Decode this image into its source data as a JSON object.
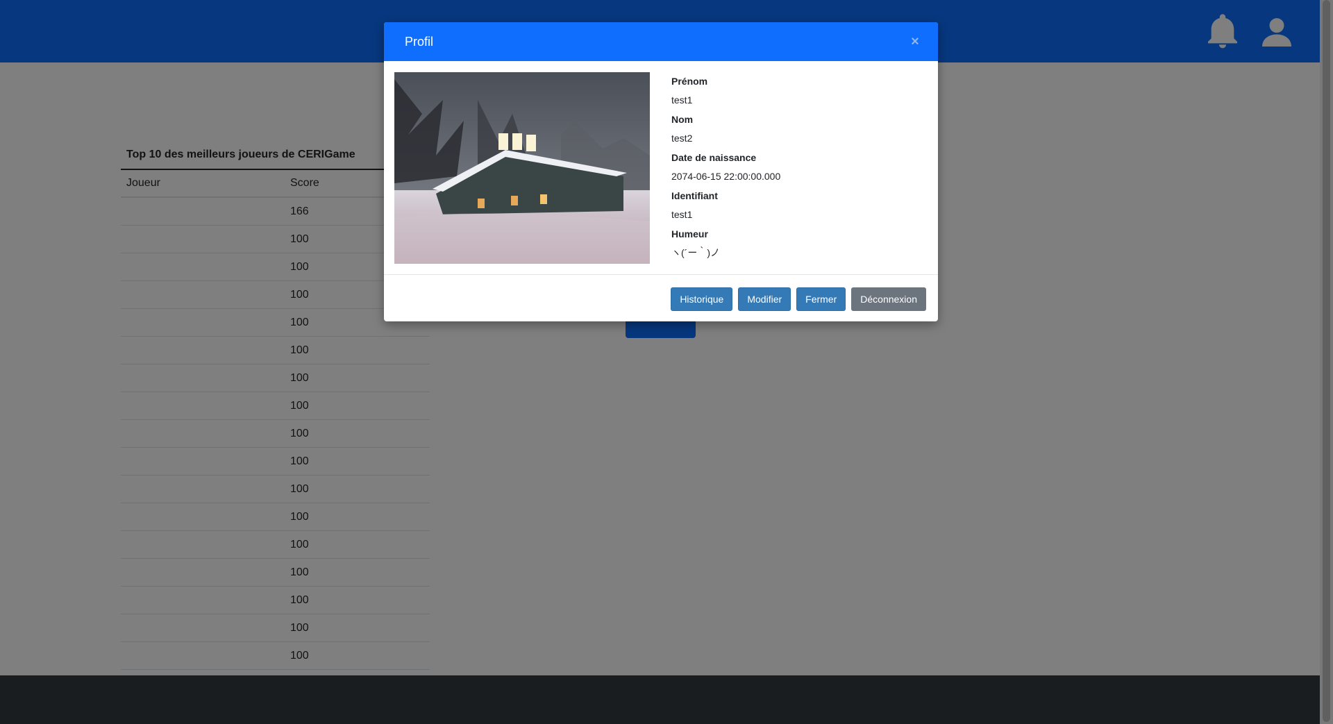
{
  "colors": {
    "navbar": "#0f6efd",
    "modal_header": "#0f6efd",
    "footer": "#343a40",
    "primary_button": "#337ab7",
    "secondary_button": "#6c757d"
  },
  "navbar": {
    "icons": [
      "bell-icon",
      "user-icon"
    ]
  },
  "leaderboard": {
    "title": "Top 10 des meilleurs joueurs de CERIGame",
    "columns": [
      "Joueur",
      "Score"
    ],
    "rows": [
      {
        "player": "",
        "score": "166"
      },
      {
        "player": "",
        "score": "100"
      },
      {
        "player": "",
        "score": "100"
      },
      {
        "player": "",
        "score": "100"
      },
      {
        "player": "",
        "score": "100"
      },
      {
        "player": "",
        "score": "100"
      },
      {
        "player": "",
        "score": "100"
      },
      {
        "player": "",
        "score": "100"
      },
      {
        "player": "",
        "score": "100"
      },
      {
        "player": "",
        "score": "100"
      },
      {
        "player": "",
        "score": "100"
      },
      {
        "player": "",
        "score": "100"
      },
      {
        "player": "",
        "score": "100"
      },
      {
        "player": "",
        "score": "100"
      },
      {
        "player": "",
        "score": "100"
      },
      {
        "player": "",
        "score": "100"
      },
      {
        "player": "",
        "score": "100"
      }
    ]
  },
  "modal": {
    "title": "Profil",
    "close_label": "×",
    "fields": [
      {
        "label": "Prénom",
        "value": "test1"
      },
      {
        "label": "Nom",
        "value": "test2"
      },
      {
        "label": "Date de naissance",
        "value": "2074-06-15 22:00:00.000"
      },
      {
        "label": "Identifiant",
        "value": "test1"
      },
      {
        "label": "Humeur",
        "value": "ヽ(´ー｀)ノ"
      }
    ],
    "buttons": {
      "history": "Historique",
      "edit": "Modifier",
      "close": "Fermer",
      "logout": "Déconnexion"
    }
  }
}
